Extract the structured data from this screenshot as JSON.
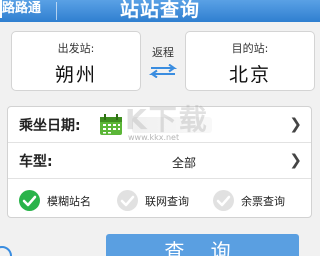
{
  "header": {
    "app_name": "路路通",
    "title": "站站查询"
  },
  "stations": {
    "from_label": "出发站:",
    "from_name": "朔州",
    "swap_label": "返程",
    "to_label": "目的站:",
    "to_name": "北京"
  },
  "options": {
    "date_label": "乘坐日期:",
    "train_type_label": "车型:",
    "train_type_value": "全部"
  },
  "checks": [
    {
      "label": "模糊站名",
      "checked": true
    },
    {
      "label": "联网查询",
      "checked": false
    },
    {
      "label": "余票查询",
      "checked": false
    }
  ],
  "buttons": {
    "query": "查 询"
  },
  "watermark": {
    "text": "K下载",
    "url": "www.kkx.net"
  },
  "colors": {
    "header": "#2f7fd0",
    "check_on": "#29b34a",
    "query_button": "#5a9fe1"
  },
  "icons": {
    "swap": "swap-arrows-icon",
    "calendar": "calendar-icon",
    "chevron": "chevron-right-icon",
    "check": "checkmark-icon",
    "help": "help-icon"
  }
}
